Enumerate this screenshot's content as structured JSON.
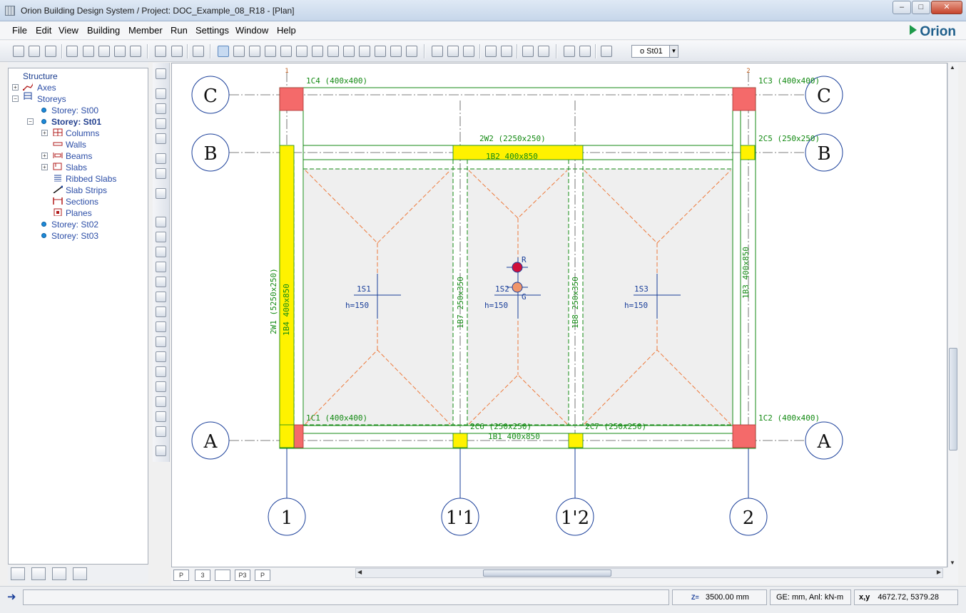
{
  "window": {
    "title": "Orion Building Design System / Project: DOC_Example_08_R18 - [Plan]",
    "brand": "Orion",
    "controls": [
      "–",
      "□",
      "✕"
    ]
  },
  "menu": {
    "items": [
      "File",
      "Edit",
      "View",
      "Building",
      "Member",
      "Run",
      "Settings",
      "Window",
      "Help"
    ]
  },
  "toolbar": {
    "storey_combo": "o  St01"
  },
  "tree": {
    "items": [
      "Structure",
      "Axes",
      "Storeys",
      "Storey: St00",
      "Storey: St01",
      "Columns",
      "Walls",
      "Beams",
      "Slabs",
      "Ribbed Slabs",
      "Slab Strips",
      "Sections",
      "Planes",
      "Storey: St02",
      "Storey: St03"
    ]
  },
  "plan": {
    "grid_rows": [
      "C",
      "B",
      "A"
    ],
    "grid_cols": [
      "1",
      "1'1",
      "1'2",
      "2"
    ],
    "axis_tick_labels": [
      "1",
      "2"
    ],
    "columns": {
      "c4": "1C4 (400x400)",
      "c3": "1C3 (400x400)",
      "c1": "1C1 (400x400)",
      "c2": "1C2 (400x400)",
      "c5": "2C5 (250x250)",
      "c6": "2C6 (250x250)",
      "c7": "2C7 (250x250)"
    },
    "walls": {
      "w2": "2W2 (2250x250)",
      "w1": "2W1 (5250x250)"
    },
    "beams": {
      "b2": "1B2 400x850",
      "b1": "1B1 400x850",
      "b4": "1B4 400x850",
      "b3": "1B3 400x850",
      "b7": "1B7 250x350",
      "b8": "1B8 250x350"
    },
    "slabs": {
      "s1": {
        "name": "1S1",
        "h": "h=150"
      },
      "s2": {
        "name": "1S2",
        "h": "h=150"
      },
      "s3": {
        "name": "1S3",
        "h": "h=150"
      }
    },
    "markers": {
      "r": "R",
      "g": "G"
    }
  },
  "status": {
    "elevation": "3500.00 mm",
    "elevation_label": "Z=",
    "units": "GE: mm, Anl: kN-m",
    "coords_label": "x,y",
    "coords": "4672.72, 5379.28"
  },
  "view_tabs": [
    "P",
    "3",
    "",
    "P3",
    "P"
  ],
  "colors": {
    "column_red": "#f46a6a",
    "wall_yellow": "#fff200",
    "beam_green": "#138a13",
    "slab_orange": "#ee7a3c",
    "axis_blue": "#1a3f9a"
  }
}
